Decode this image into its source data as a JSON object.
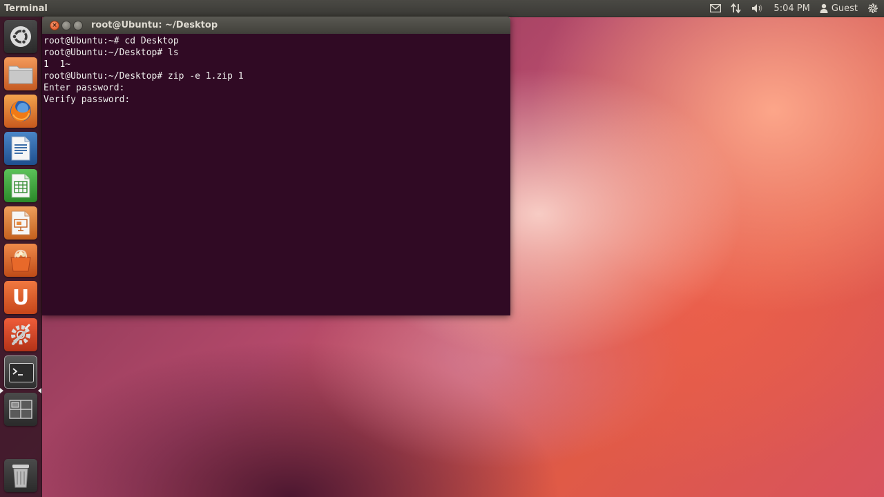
{
  "top_panel": {
    "app_title": "Terminal",
    "clock": "5:04 PM",
    "user": "Guest",
    "icons": [
      "mail-icon",
      "network-icon",
      "volume-icon",
      "user-icon",
      "power-gear-icon"
    ]
  },
  "launcher": {
    "items": [
      {
        "name": "dash-home-icon"
      },
      {
        "name": "files-icon"
      },
      {
        "name": "firefox-icon"
      },
      {
        "name": "libreoffice-writer-icon"
      },
      {
        "name": "libreoffice-calc-icon"
      },
      {
        "name": "libreoffice-impress-icon"
      },
      {
        "name": "software-center-icon"
      },
      {
        "name": "ubuntu-one-icon"
      },
      {
        "name": "system-settings-icon"
      },
      {
        "name": "terminal-icon"
      },
      {
        "name": "workspace-switcher-icon"
      },
      {
        "name": "trash-icon"
      }
    ],
    "ubuntu_one_letter": "U",
    "active_item": "terminal-icon"
  },
  "window": {
    "title": "root@Ubuntu: ~/Desktop",
    "close_glyph": "×",
    "min_glyph": "",
    "max_glyph": ""
  },
  "terminal": {
    "lines": [
      "root@Ubuntu:~# cd Desktop",
      "root@Ubuntu:~/Desktop# ls",
      "1  1~",
      "root@Ubuntu:~/Desktop# zip -e 1.zip 1",
      "Enter password:",
      "Verify password:"
    ]
  },
  "colors": {
    "terminal_bg": "#300a24",
    "terminal_fg": "#eeeeec",
    "close_button": "#df4a16",
    "panel_bg": "#3b3a36"
  }
}
